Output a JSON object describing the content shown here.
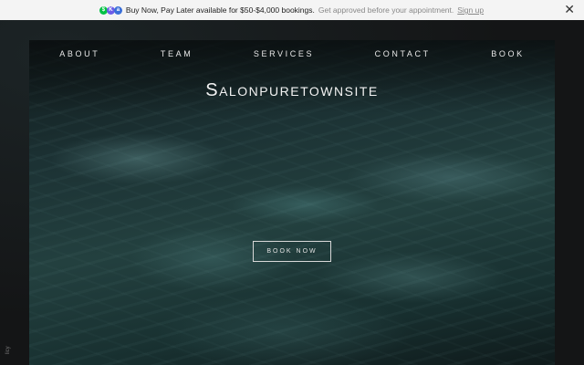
{
  "promo": {
    "logos": [
      {
        "name": "cash-app-logo",
        "color": "#00c244",
        "glyph": "$"
      },
      {
        "name": "klarna-logo",
        "color": "#6c5ce7",
        "glyph": "K"
      },
      {
        "name": "afterpay-logo",
        "color": "#3a6fd8",
        "glyph": "a"
      }
    ],
    "headline": "Buy Now, Pay Later available for $50-$4,000 bookings.",
    "subtext": "Get approved before your appointment.",
    "link": "Sign up",
    "close_icon": "close-icon"
  },
  "nav": {
    "items": [
      "ABOUT",
      "TEAM",
      "SERVICES",
      "CONTACT",
      "BOOK"
    ]
  },
  "hero": {
    "title": "Salonpuretownsite",
    "cta": "BOOK NOW",
    "background": "dark teal water ripples"
  },
  "side_text": "licy",
  "colors": {
    "page_bg": "#141516",
    "promo_bg": "#f4f4f4",
    "text_light": "#e8e8e8"
  }
}
